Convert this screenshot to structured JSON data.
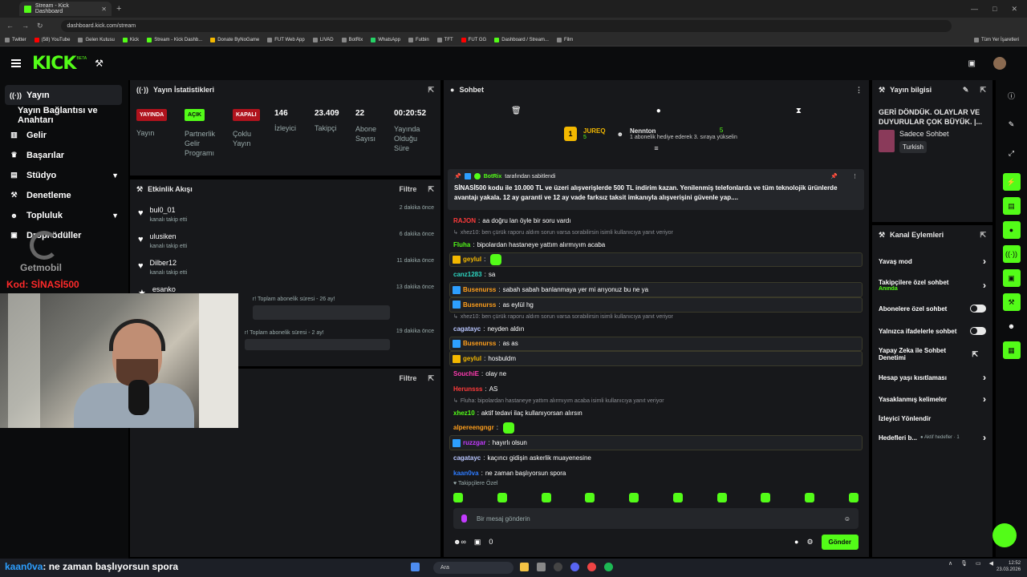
{
  "browser": {
    "tab_title": "Stream - Kick Dashboard",
    "url": "dashboard.kick.com/stream",
    "bookmarks": [
      "Twitter",
      "(58) YouTube",
      "Gelen Kutusu",
      "Kick",
      "Stream - Kick Dashb...",
      "Donate ByNoGame",
      "FUT Web App",
      "LIVAD",
      "BotRix",
      "WhatsApp",
      "Futbin",
      "TFT",
      "FUT GG",
      "Dashboard / Stream...",
      "Film"
    ],
    "bookmarks_right": "Tüm Yer İşaretleri"
  },
  "header": {
    "logo": "KICK",
    "beta": "BETA"
  },
  "sidebar": {
    "items": [
      {
        "label": "Yayın",
        "icon": "broadcast-icon"
      },
      {
        "label": "Yayın Bağlantısı ve Anahtarı"
      },
      {
        "label": "Gelir",
        "icon": "chart-icon"
      },
      {
        "label": "Başarılar",
        "icon": "trophy-icon"
      },
      {
        "label": "Stüdyo",
        "icon": "studio-icon"
      },
      {
        "label": "Denetleme",
        "icon": "hammer-icon"
      },
      {
        "label": "Topluluk",
        "icon": "community-icon"
      },
      {
        "label": "Dropl  ödüller",
        "icon": "gift-icon"
      }
    ],
    "promo_brand": "Getmobil",
    "promo_code": "Kod: SİNASİ500"
  },
  "stats": {
    "title": "Yayın İstatistikleri",
    "items": [
      {
        "badge": "YAYINDA",
        "label": "Yayın"
      },
      {
        "badge": "AÇIK",
        "label": "Partnerlik Gelir Programı"
      },
      {
        "badge": "KAPALI",
        "label": "Çoklu Yayın"
      },
      {
        "value": "146",
        "label": "İzleyici"
      },
      {
        "value": "23.409",
        "label": "Takipçi"
      },
      {
        "value": "22",
        "label": "Abone Sayısı"
      },
      {
        "value": "00:20:52",
        "label": "Yayında Olduğu Süre"
      }
    ]
  },
  "activity": {
    "title": "Etkinlik Akışı",
    "filter": "Filtre",
    "items": [
      {
        "name": "bul0_01",
        "sub": "kanalı takip etti",
        "time": "2 dakika önce"
      },
      {
        "name": "ulusiken",
        "sub": "kanalı takip etti",
        "time": "6 dakika önce"
      },
      {
        "name": "Dilber12",
        "sub": "kanalı takip etti",
        "time": "11 dakika önce"
      },
      {
        "name": "esanko",
        "sub": "r! Toplam abonelik süresi - 26 ay!",
        "time": "13 dakika önce"
      },
      {
        "name": "",
        "sub": "r! Toplam abonelik süresi - 2 ay!",
        "time": "19 dakika önce"
      }
    ],
    "lower_filter": "Filtre"
  },
  "chat": {
    "title": "Sohbet",
    "top_gifter": {
      "name": "JUREQ",
      "count": "5"
    },
    "top_user": {
      "name": "Nennton",
      "count": "5",
      "note": "1 abonelik hediye ederek 3. sıraya yükselin"
    },
    "pinned_by": "BotRix",
    "pinned_label": "tarafından sabitlendi",
    "pinned_text": "SİNASİ500 kodu ile 10.000 TL ve üzeri alışverişlerde 500 TL indirim kazan.  Yenilenmiş telefonlarda ve tüm teknolojik ürünlerde avantajı yakala. 12 ay garanti ve 12 ay vade farksız taksit imkanıyla alışverişini güvenle yap....",
    "messages": [
      {
        "user": "RAJON",
        "text": "aa doğru lan öyle bir soru vardı",
        "color": "#ff3b3b"
      },
      {
        "reply": "xhez10: ben çürük raporu aldım sorun varsa sorabilirsin isimli kullanıcıya yanıt veriyor"
      },
      {
        "user": "Fluha",
        "text": "bipolardan hastaneye yattım alırmıyım acaba",
        "color": "#53fc18"
      },
      {
        "user": "geylul",
        "text": "",
        "color": "#f3b800",
        "badge": "crown",
        "hl": true
      },
      {
        "user": "canz1283",
        "text": "sa",
        "color": "#2dd4bf"
      },
      {
        "user": "Busenurss",
        "text": "sabah sabah banlanmaya yer mi arıyonuz bu ne ya",
        "color": "#ff9f1c",
        "badge": "box",
        "hl": true
      },
      {
        "user": "Busenurss",
        "text": "as eylül hg",
        "color": "#ff9f1c",
        "badge": "box",
        "hl": true
      },
      {
        "reply": "xhez10: ben çürük raporu aldım sorun varsa sorabilirsin isimli kullanıcıya yanıt veriyor"
      },
      {
        "user": "cagatayc",
        "text": "neyden aldın",
        "color": "#b9c6ff"
      },
      {
        "user": "Busenurss",
        "text": "as as",
        "color": "#ff9f1c",
        "badge": "box",
        "hl": true
      },
      {
        "user": "geylul",
        "text": "hosbuldm",
        "color": "#f3b800",
        "badge": "crown",
        "hl": true
      },
      {
        "user": "SouchiE",
        "text": "olay ne",
        "color": "#ff3bb0"
      },
      {
        "user": "Herunsss",
        "text": "AS",
        "color": "#ff3b3b"
      },
      {
        "reply": "Fluha: bipolardan hastaneye yattım alırmıyım acaba isimli kullanıcıya yanıt veriyor"
      },
      {
        "user": "xhez10",
        "text": "aktif tedavi ilaç kullanıyorsan alırsın",
        "color": "#53fc18"
      },
      {
        "user": "alpereengngr",
        "text": "",
        "color": "#ff9f1c"
      },
      {
        "user": "ruzzgar",
        "text": "hayırlı olsun",
        "color": "#c33bff",
        "badge": "box",
        "hl": true
      },
      {
        "user": "cagatayc",
        "text": "kaçıncı gidişin askerlik muayenesine",
        "color": "#b9c6ff"
      },
      {
        "user": "kaan0va",
        "text": "ne zaman başlıyorsun spora",
        "color": "#2d7bff"
      }
    ],
    "followers_only": "Takipçilere Özel",
    "input_placeholder": "Bir mesaj gönderin",
    "count": "0",
    "send": "Gönder"
  },
  "info": {
    "title": "Yayın bilgisi",
    "stream_title": "GERİ DÖNDÜK. OLAYLAR VE DUYURULAR ÇOK BÜYÜK. |...",
    "category": "Sadece Sohbet",
    "language": "Turkish"
  },
  "channel_actions": {
    "title": "Kanal Eylemleri",
    "items": [
      {
        "label": "Yavaş mod",
        "type": "chevron"
      },
      {
        "label": "Takipçilere özel sohbet",
        "sub": "Anında",
        "type": "chevron"
      },
      {
        "label": "Abonelere özel sohbet",
        "type": "toggle"
      },
      {
        "label": "Yalnızca ifadelerle sohbet",
        "type": "toggle"
      },
      {
        "label": "Yapay Zeka ile Sohbet Denetimi",
        "type": "external"
      },
      {
        "label": "Hesap yaşı kısıtlaması",
        "type": "chevron"
      },
      {
        "label": "Yasaklanmış kelimeler",
        "type": "chevron"
      },
      {
        "label": "İzleyici Yönlendir",
        "type": "none"
      },
      {
        "label": "Hedefleri b...",
        "sub": "Aktif hedefler · 1",
        "type": "chevron"
      }
    ]
  },
  "overlay_caption": {
    "name": "kaan0va",
    "text": ": ne zaman başlıyorsun spora"
  },
  "taskbar": {
    "search": "Ara",
    "time": "12:52",
    "date": "23.03.2026"
  }
}
